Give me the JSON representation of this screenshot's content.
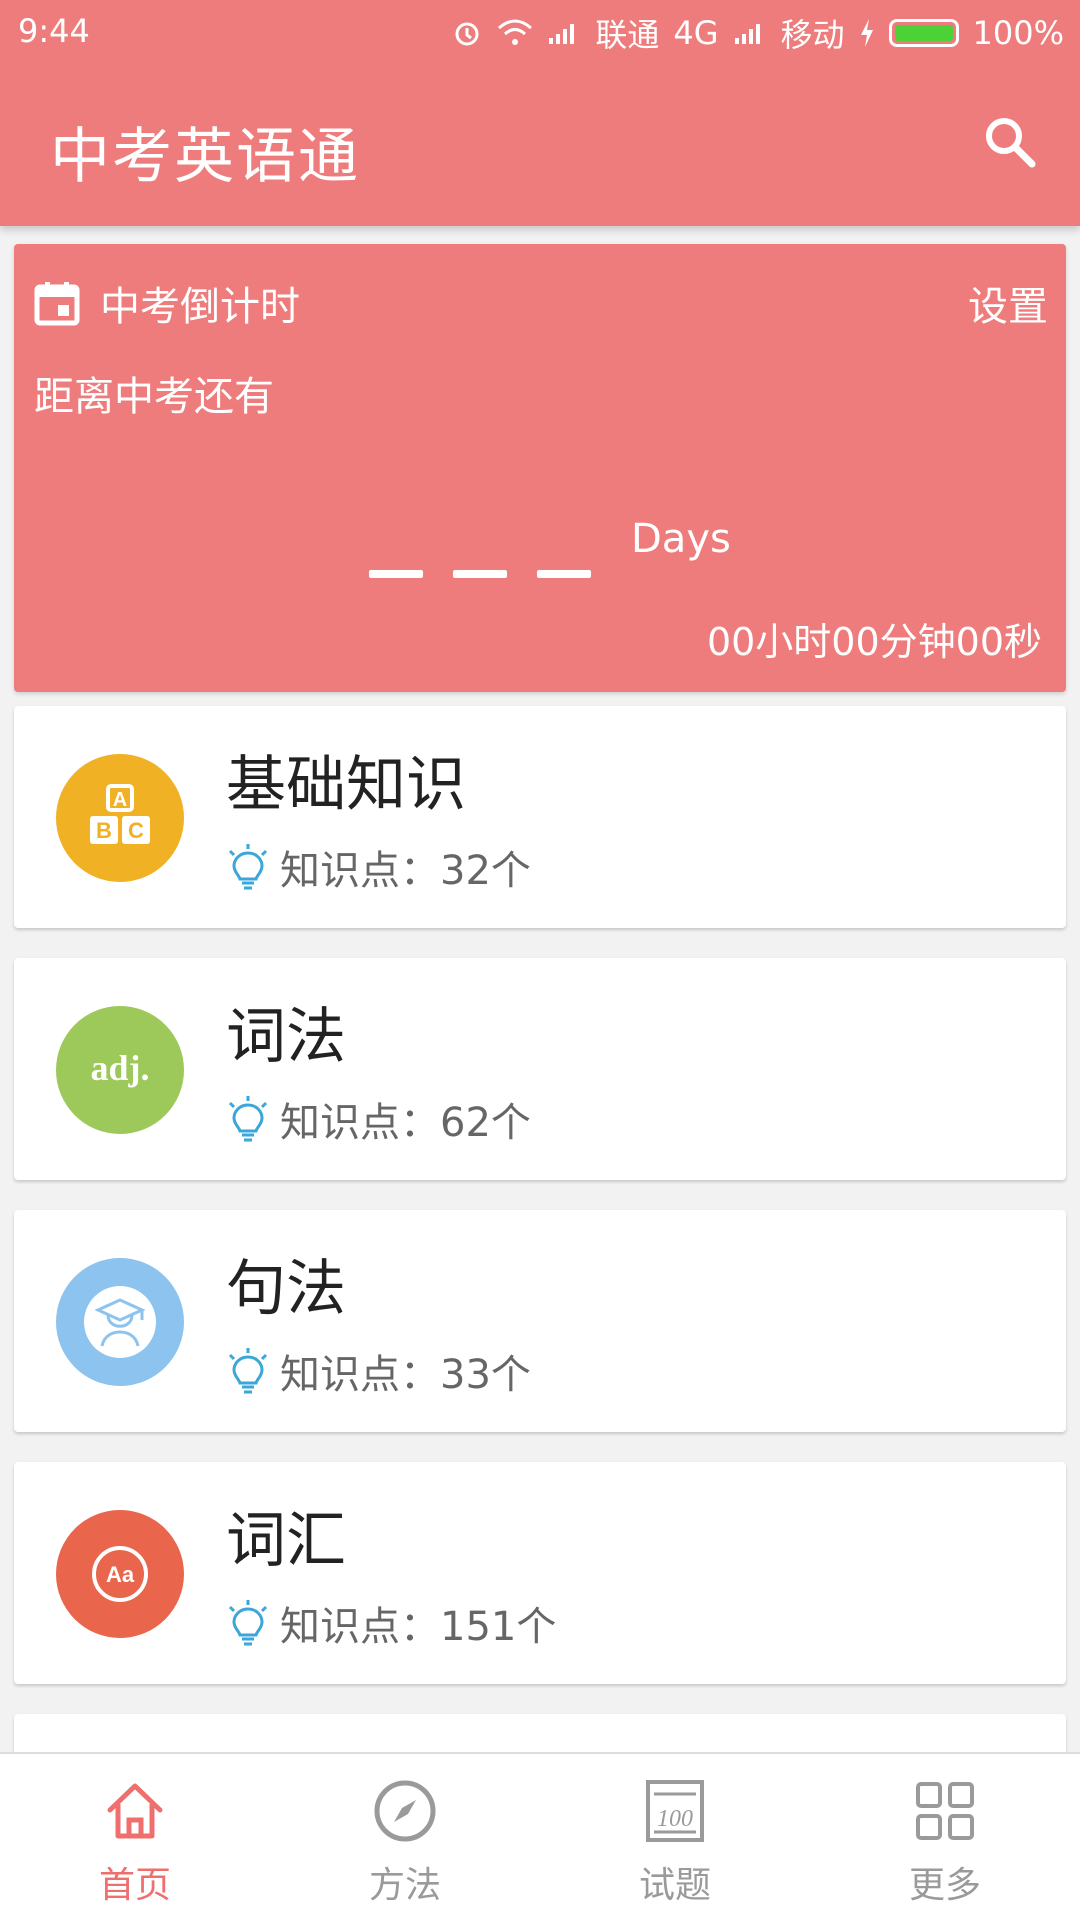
{
  "status_bar": {
    "time": "9:44",
    "carrier1": "联通",
    "network": "4G",
    "carrier2": "移动",
    "battery": "100%"
  },
  "app_bar": {
    "title": "中考英语通",
    "search_icon": "search-icon"
  },
  "countdown": {
    "title": "中考倒计时",
    "settings_label": "设置",
    "subtitle": "距离中考还有",
    "days_label": "Days",
    "time_remaining": "00小时00分钟00秒",
    "icon": "calendar-icon"
  },
  "categories": [
    {
      "title": "基础知识",
      "meta": "知识点：32个",
      "icon": "abc-blocks-icon",
      "color": "#f0b124"
    },
    {
      "title": "词法",
      "meta": "知识点：62个",
      "icon": "adj-icon",
      "color": "#9dc85a"
    },
    {
      "title": "句法",
      "meta": "知识点：33个",
      "icon": "graduate-icon",
      "color": "#8cc3ef"
    },
    {
      "title": "词汇",
      "meta": "知识点：151个",
      "icon": "aa-icon",
      "color": "#e9664d"
    }
  ],
  "bottom_nav": [
    {
      "label": "首页",
      "icon": "home-icon",
      "active": true
    },
    {
      "label": "方法",
      "icon": "compass-icon",
      "active": false
    },
    {
      "label": "试题",
      "icon": "exam-icon",
      "active": false
    },
    {
      "label": "更多",
      "icon": "grid-icon",
      "active": false
    }
  ],
  "colors": {
    "primary": "#ef7c7c",
    "nav_active": "#ef6f6f",
    "bulb": "#3aa7d8"
  }
}
